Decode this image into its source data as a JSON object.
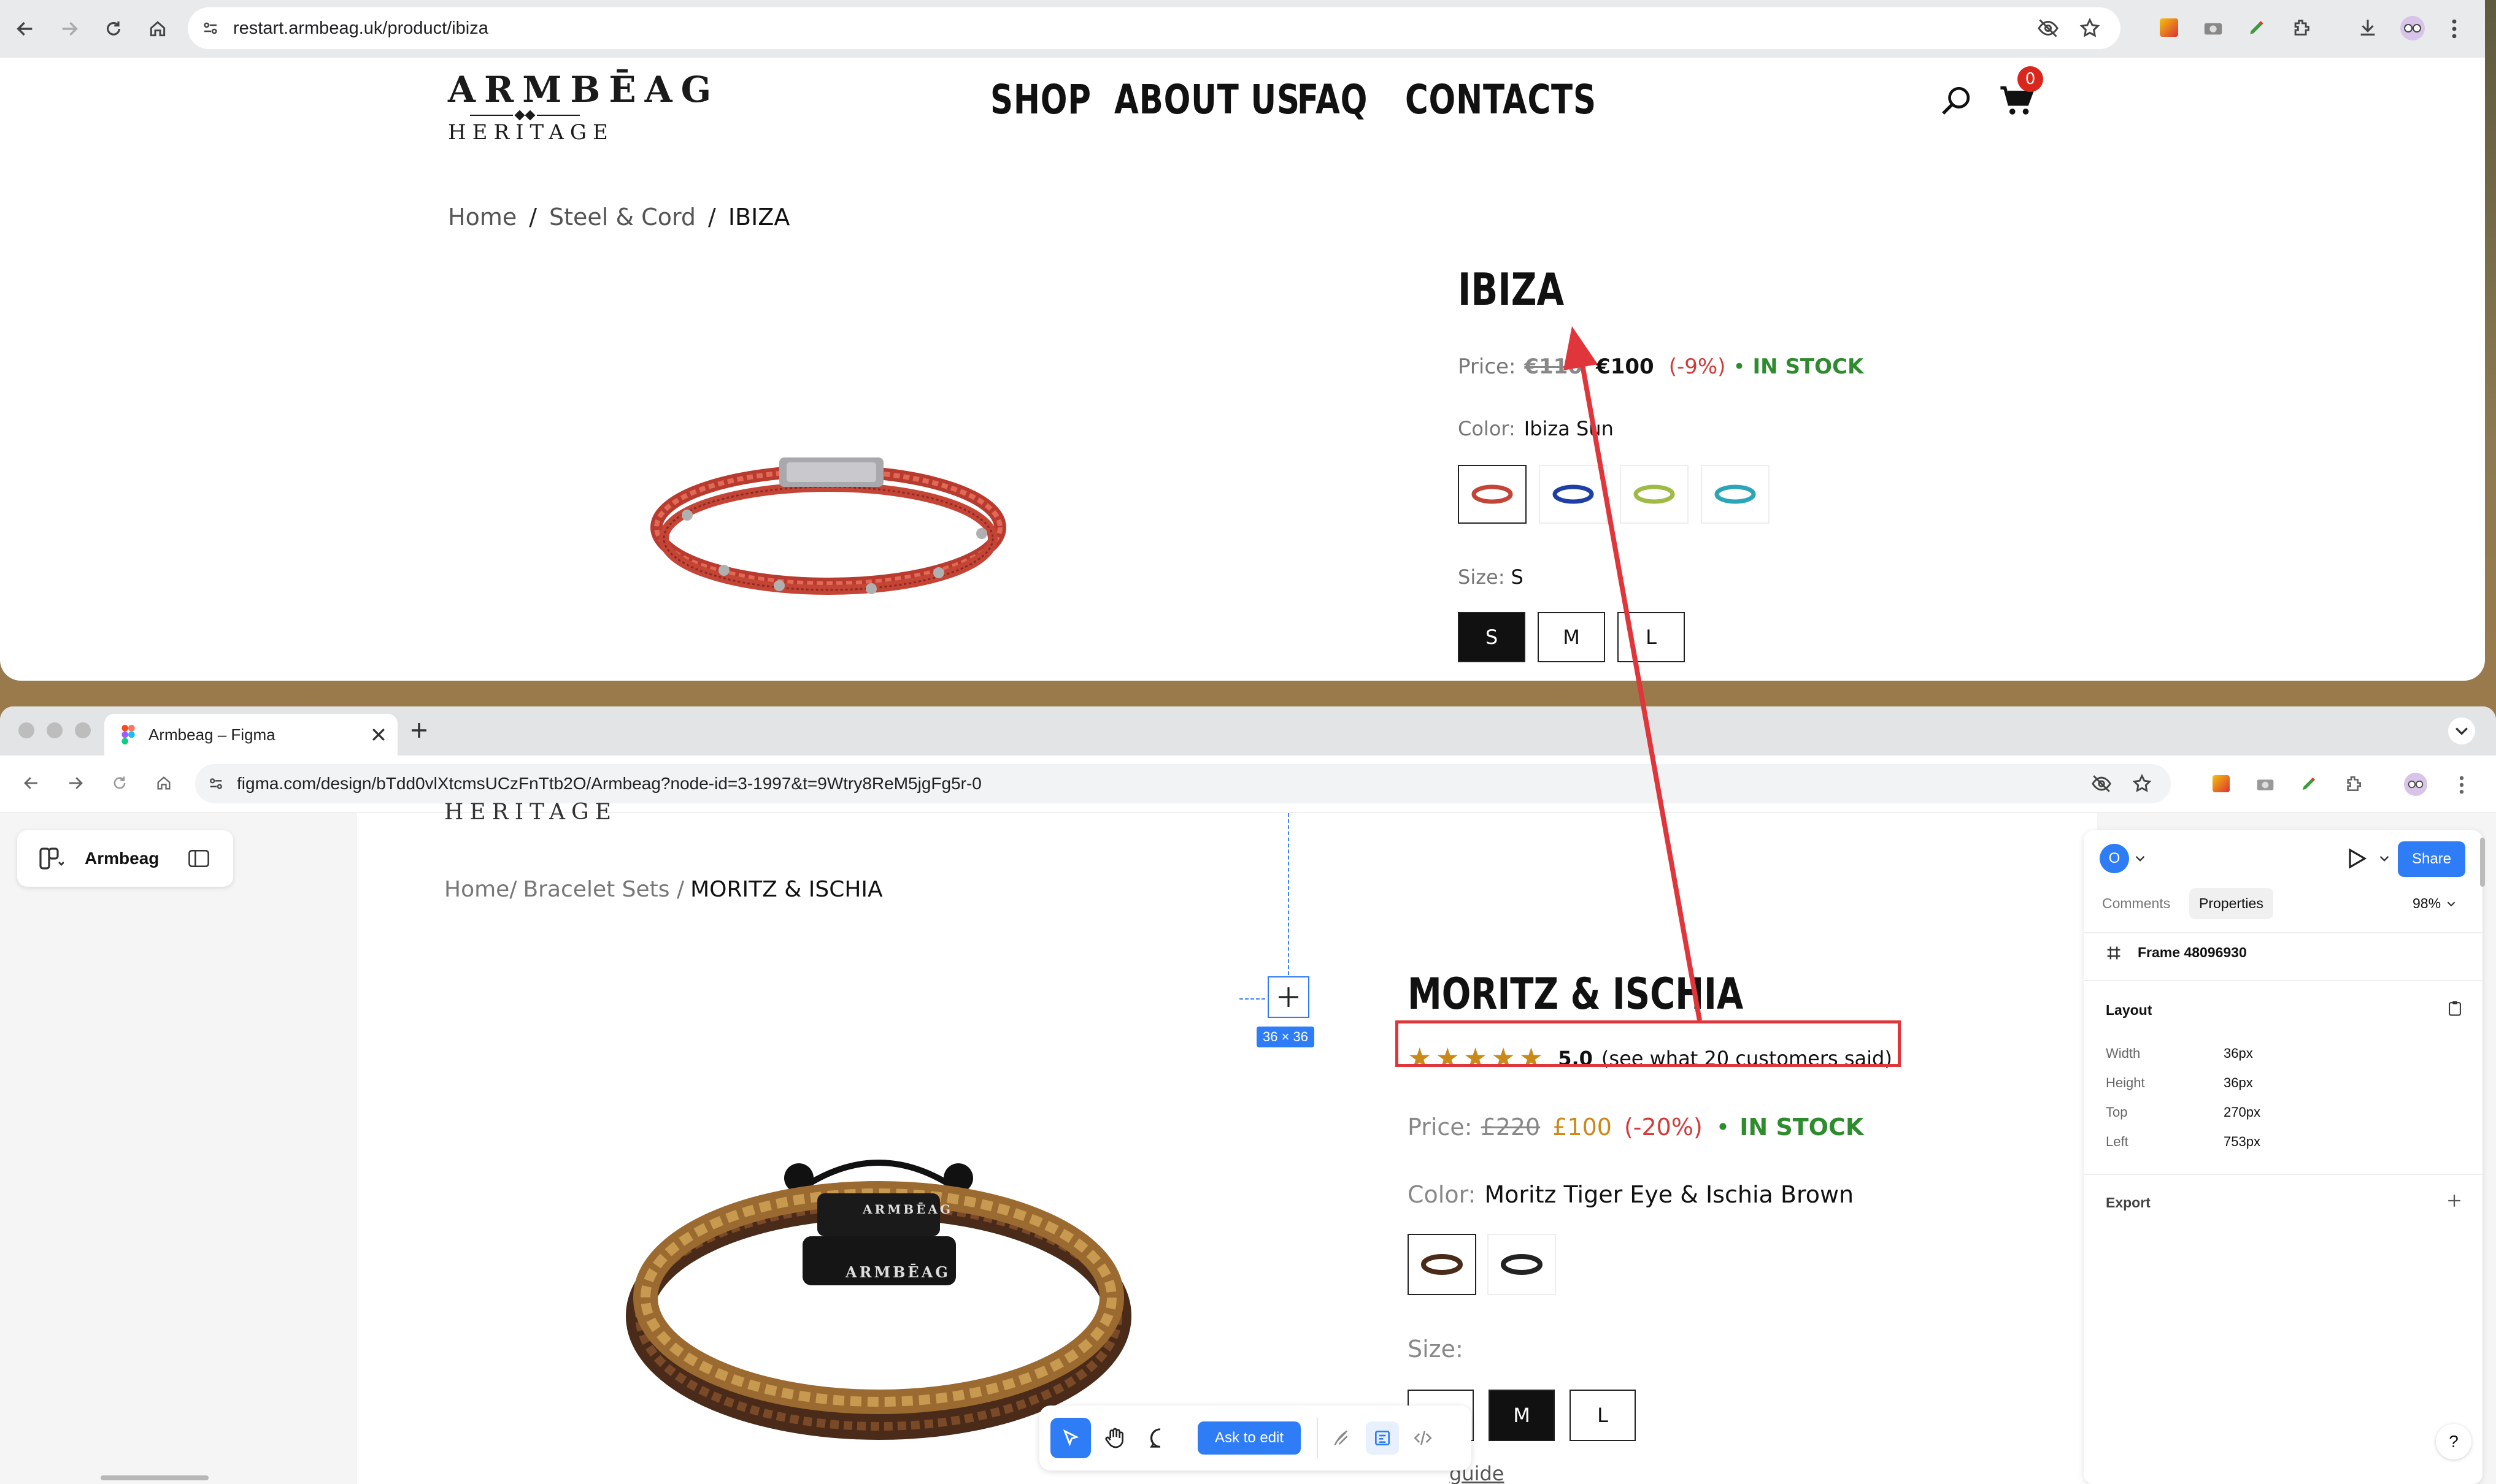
{
  "top_browser": {
    "url": "restart.armbeag.uk/product/ibiza",
    "cart_count": "0"
  },
  "site": {
    "logo": {
      "main": "ARMBĒAG",
      "sub": "HERITAGE"
    },
    "nav": [
      "SHOP",
      "ABOUT US",
      "FAQ",
      "CONTACTS"
    ]
  },
  "product_page": {
    "breadcrumb": {
      "home": "Home",
      "sep": "/",
      "category": "Steel & Cord",
      "current": "IBIZA"
    },
    "title": "IBIZA",
    "price": {
      "label": "Price:",
      "old": "€110",
      "new": "€100",
      "discount": "(-9%)",
      "dot": "•",
      "stock": "IN STOCK"
    },
    "color": {
      "label": "Color:",
      "value": "Ibiza Sun"
    },
    "swatches": [
      "red",
      "blue",
      "green",
      "turquoise"
    ],
    "size": {
      "label": "Size:",
      "value": "S",
      "options": [
        "S",
        "M",
        "L"
      ],
      "selected": "S"
    }
  },
  "figma_browser": {
    "tab_title": "Armbeag – Figma",
    "url": "figma.com/design/bTdd0vlXtcmsUCzFnTtb2O/Armbeag?node-id=3-1997&t=9Wtry8ReM5jgFg5r-0",
    "file_name": "Armbeag"
  },
  "figma_design": {
    "logo_fragment": "HERITAGE",
    "breadcrumb": {
      "home": "Home/",
      "category": "Bracelet Sets /",
      "current": "MORITZ & ISCHIA"
    },
    "title": "MORITZ & ISCHIA",
    "rating": {
      "stars": 5,
      "score": "5.0",
      "text": "(see what 20 customers said)"
    },
    "price": {
      "label": "Price:",
      "old": "£220",
      "new": "£100",
      "discount": "(-20%)",
      "dot": "•",
      "stock": "IN STOCK"
    },
    "color": {
      "label": "Color:",
      "value": "Moritz Tiger Eye & Ischia Brown"
    },
    "size": {
      "label": "Size:",
      "options": [
        "S",
        "M",
        "L"
      ],
      "selected": "M"
    },
    "size_guide_fragment": "guide",
    "selection_badge": "36 × 36"
  },
  "figma_panel": {
    "avatar_initial": "O",
    "share_label": "Share",
    "tabs": [
      "Comments",
      "Properties"
    ],
    "active_tab": "Properties",
    "zoom": "98%",
    "frame_name": "Frame 48096930",
    "layout_title": "Layout",
    "layout": [
      {
        "label": "Width",
        "value": "36px"
      },
      {
        "label": "Height",
        "value": "36px"
      },
      {
        "label": "Top",
        "value": "270px"
      },
      {
        "label": "Left",
        "value": "753px"
      }
    ],
    "export_title": "Export"
  },
  "figma_toolbar": {
    "ask_to_edit": "Ask to edit",
    "help": "?"
  },
  "colors": {
    "accent_blue": "#2f7df6",
    "annotation_red": "#e0353a",
    "sale_red": "#d43a3a",
    "stock_green": "#2e8b2e",
    "star_gold": "#c98a1a"
  }
}
